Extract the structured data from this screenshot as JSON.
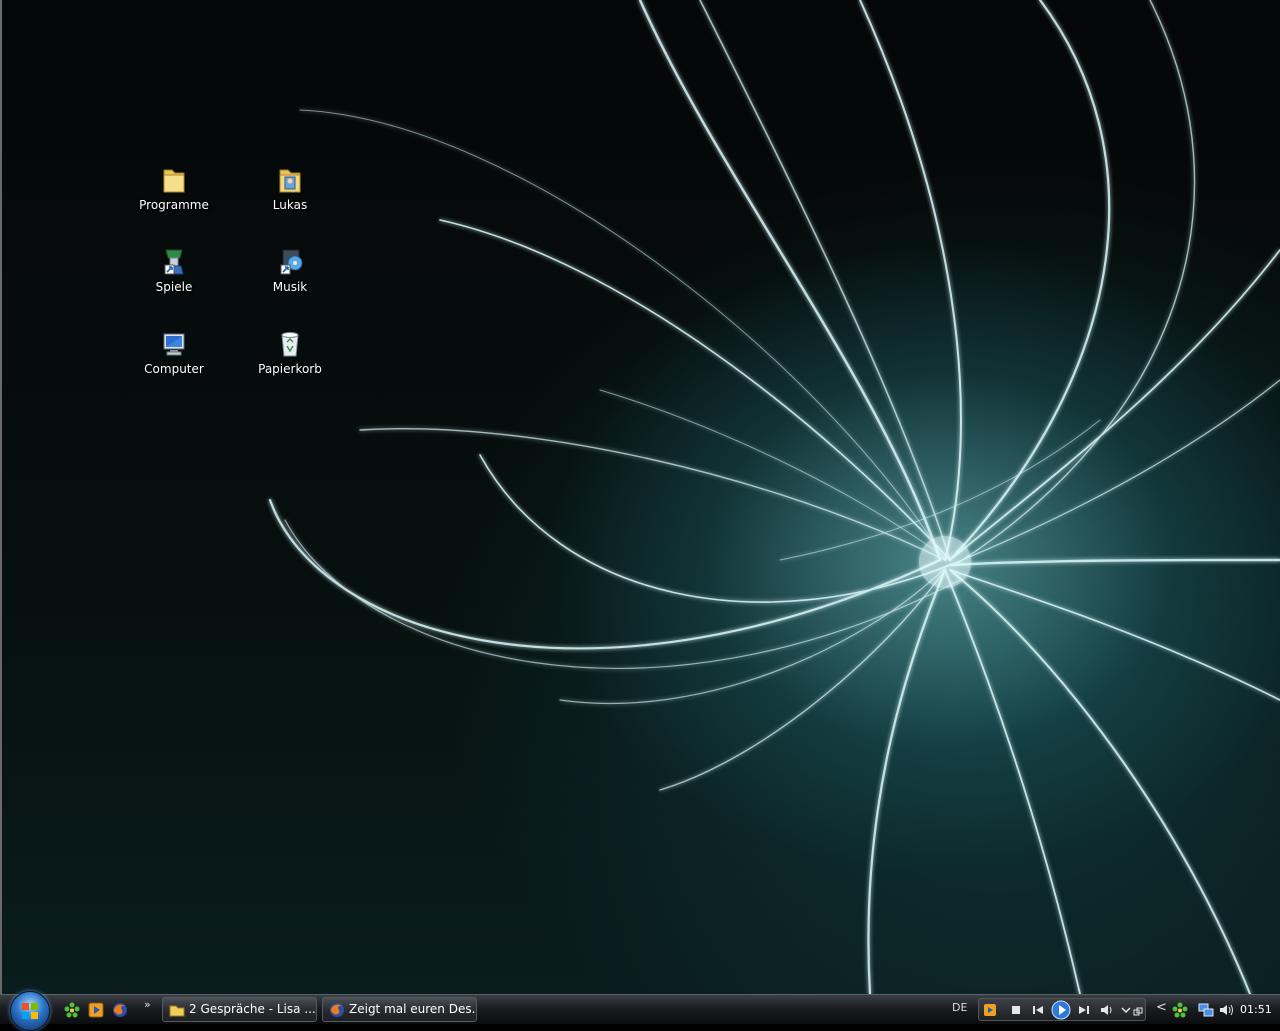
{
  "desktop": {
    "icons": [
      {
        "label": "Programme",
        "icon": "folder-icon"
      },
      {
        "label": "Lukas",
        "icon": "user-folder-icon"
      },
      {
        "label": "Spiele",
        "icon": "games-shortcut-icon"
      },
      {
        "label": "Musik",
        "icon": "music-shortcut-icon"
      },
      {
        "label": "Computer",
        "icon": "computer-icon"
      },
      {
        "label": "Papierkorb",
        "icon": "recycle-bin-icon"
      }
    ]
  },
  "taskbar": {
    "start_icon": "windows-start-orb-icon",
    "quick_launch": [
      "icq-flower-icon",
      "media-player-icon",
      "firefox-icon"
    ],
    "overflow_label": "»",
    "tasks": [
      {
        "label": "2 Gespräche - Lisa ...",
        "icon": "chat-window-icon"
      },
      {
        "label": "Zeigt mal euren Des...",
        "icon": "firefox-icon"
      }
    ],
    "language": "DE",
    "tray_expand": "<",
    "clock": "01:51"
  },
  "colors": {
    "accent_glow": "#8fd3d6",
    "taskbar": "#1b1d20"
  }
}
